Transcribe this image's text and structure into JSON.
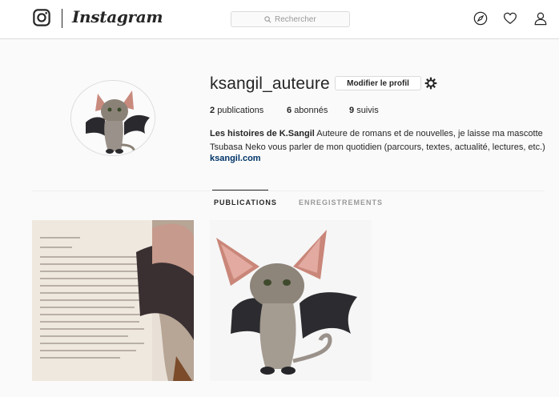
{
  "header": {
    "brand": "Instagram",
    "search_placeholder": "Rechercher"
  },
  "profile": {
    "username": "ksangil_auteure",
    "edit_label": "Modifier le profil",
    "stats": [
      {
        "value": "2",
        "label": "publications"
      },
      {
        "value": "6",
        "label": "abonnés"
      },
      {
        "value": "9",
        "label": "suivis"
      }
    ],
    "bio_name": "Les histoires de K.Sangil",
    "bio_text": "Auteure de romans et de nouvelles, je laisse ma mascotte Tsubasa Neko vous parler de mon quotidien (parcours, textes, actualité, lectures, etc.)",
    "website": "ksangil.com"
  },
  "tabs": [
    {
      "label": "PUBLICATIONS",
      "active": true
    },
    {
      "label": "ENREGISTREMENTS",
      "active": false
    }
  ],
  "posts": [
    {
      "subject": "book-page-with-cat-figurine"
    },
    {
      "subject": "cat-figurine-with-bat-wings"
    }
  ]
}
